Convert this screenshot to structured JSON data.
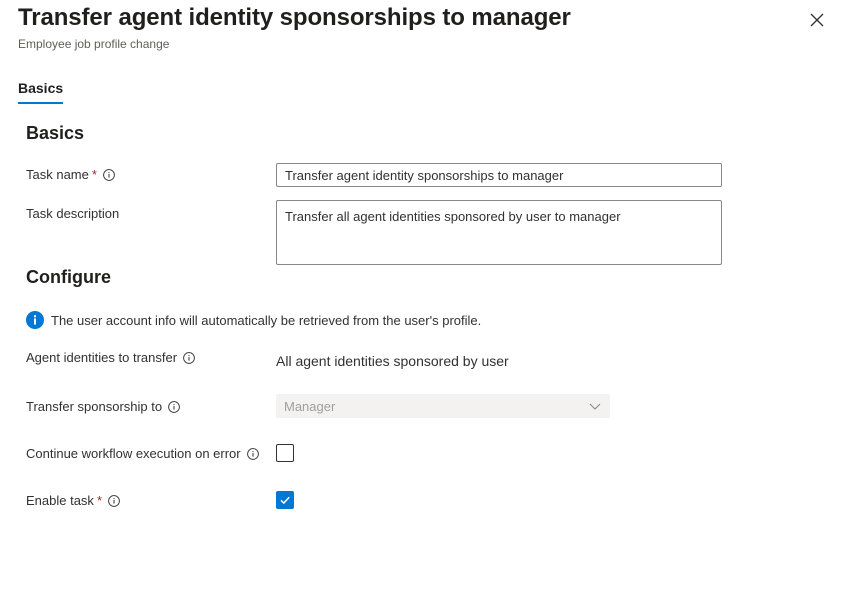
{
  "header": {
    "title": "Transfer agent identity sponsorships to manager",
    "subtitle": "Employee job profile change",
    "close_icon": "close-icon"
  },
  "tabs": [
    {
      "label": "Basics",
      "selected": true
    }
  ],
  "basics": {
    "heading": "Basics",
    "task_name": {
      "label": "Task name",
      "required_marker": "*",
      "value": "Transfer agent identity sponsorships to manager"
    },
    "task_description": {
      "label": "Task description",
      "value": "Transfer all agent identities sponsored by user to manager"
    }
  },
  "configure": {
    "heading": "Configure",
    "info_message": "The user account info will automatically be retrieved from the user's profile.",
    "agent_identities": {
      "label": "Agent identities to transfer",
      "value": "All agent identities sponsored by user"
    },
    "transfer_sponsorship": {
      "label": "Transfer sponsorship to",
      "selected": "Manager",
      "disabled": true
    },
    "continue_on_error": {
      "label": "Continue workflow execution on error",
      "checked": false
    },
    "enable_task": {
      "label": "Enable task",
      "required_marker": "*",
      "checked": true
    }
  },
  "colors": {
    "accent": "#0078d4",
    "required": "#a4262c",
    "text": "#323130"
  }
}
